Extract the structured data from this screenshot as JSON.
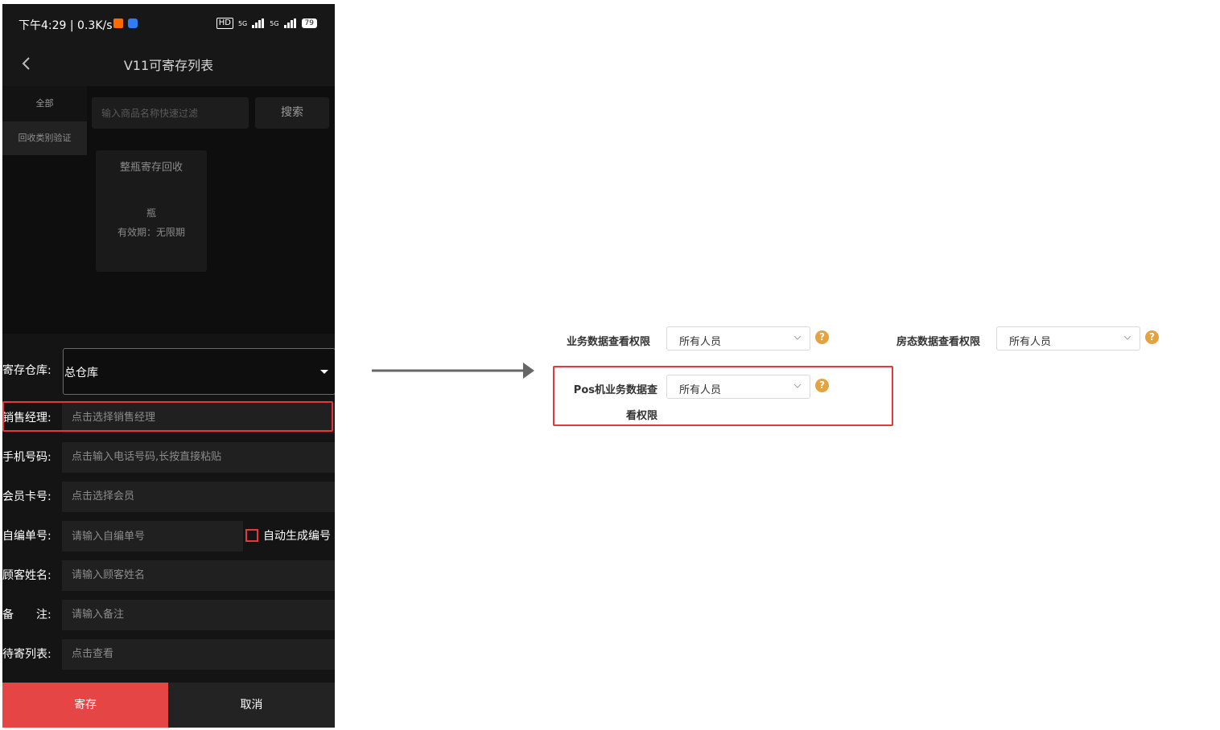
{
  "phone": {
    "status": {
      "time": "下午4:29 | 0.3K/s",
      "hd": "HD",
      "net1": "5G",
      "net2": "5G",
      "battery": "79"
    },
    "nav": {
      "title": "V11可寄存列表"
    },
    "categories": [
      {
        "label": "全部"
      },
      {
        "label": "回收类别验证"
      }
    ],
    "search": {
      "placeholder": "输入商品名称快速过滤",
      "button_label": "搜索"
    },
    "product": {
      "name": "整瓶寄存回收",
      "unit": "瓶",
      "expiry": "有效期：无限期"
    },
    "form": {
      "warehouse": {
        "label": "寄存仓库:",
        "value": "总仓库"
      },
      "manager": {
        "label": "销售经理:",
        "placeholder": "点击选择销售经理"
      },
      "phone_no": {
        "label": "手机号码:",
        "placeholder": "点击输入电话号码,长按直接粘贴"
      },
      "member": {
        "label": "会员卡号:",
        "placeholder": "点击选择会员"
      },
      "self_no": {
        "label": "自编单号:",
        "placeholder": "请输入自编单号",
        "checkbox_label": "自动生成编号"
      },
      "customer": {
        "label": "顾客姓名:",
        "placeholder": "请输入顾客姓名"
      },
      "remark": {
        "label": "备　　注:",
        "placeholder": "请输入备注"
      },
      "pending": {
        "label": "待寄列表:",
        "placeholder": "点击查看"
      }
    },
    "actions": {
      "save": "寄存",
      "cancel": "取消"
    }
  },
  "web": {
    "business": {
      "label": "业务数据查看权限",
      "value": "所有人员"
    },
    "room": {
      "label": "房态数据查看权限",
      "value": "所有人员"
    },
    "pos": {
      "label": "Pos机业务数据查看权限",
      "value": "所有人员"
    },
    "help_glyph": "?"
  },
  "colors": {
    "accent": "#e54544",
    "highlight": "#e5383b",
    "help": "#e6a23c"
  }
}
